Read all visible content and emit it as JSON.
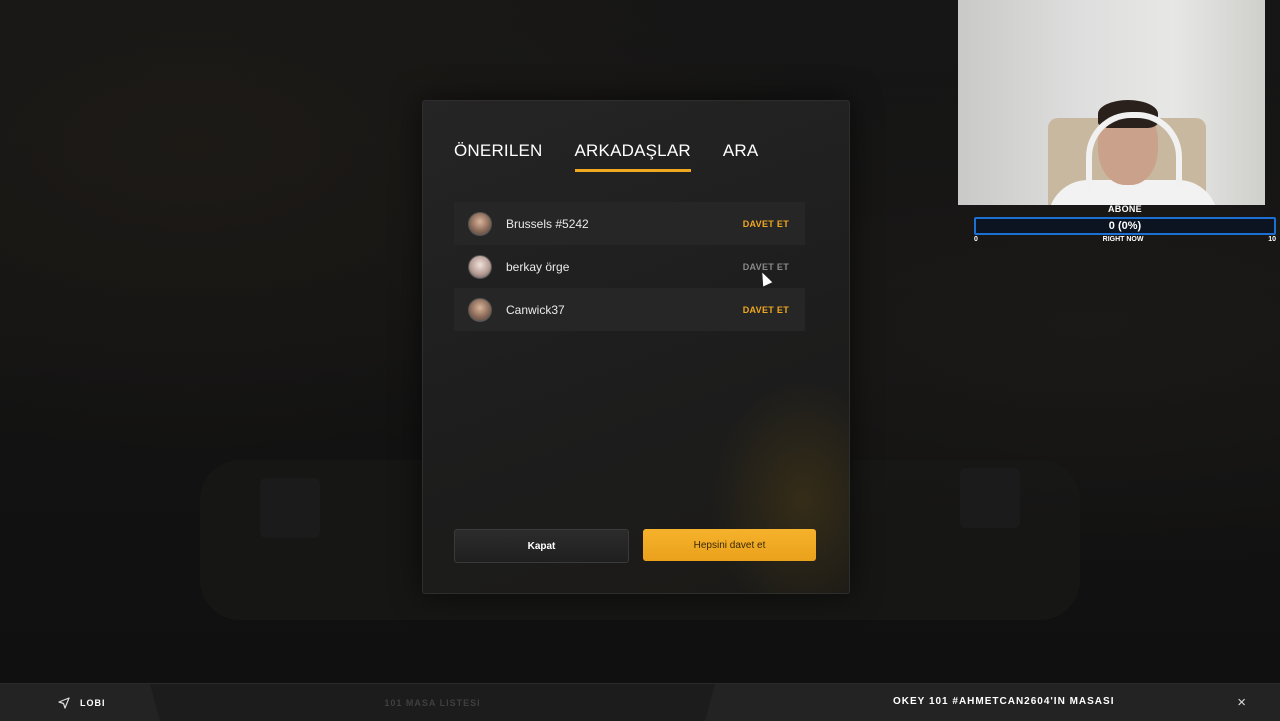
{
  "modal": {
    "tabs": [
      {
        "label": "ÖNERILEN",
        "active": false
      },
      {
        "label": "ARKADAŞLAR",
        "active": true
      },
      {
        "label": "ARA",
        "active": false
      }
    ],
    "friends": [
      {
        "name": "Brussels #5242",
        "action": "DAVET ET"
      },
      {
        "name": "berkay örge",
        "action": "DAVET ET"
      },
      {
        "name": "Canwick37",
        "action": "DAVET ET"
      }
    ],
    "close_label": "Kapat",
    "invite_all_label": "Hepsini davet et",
    "accent_color": "#f0a820"
  },
  "webcam_overlay": {
    "title": "ABONE",
    "progress_text": "0 (0%)",
    "progress_value": 0,
    "scale_min": "0",
    "scale_label": "RIGHT NOW",
    "scale_max": "10"
  },
  "bottom_bar": {
    "lobby_label": "LOBI",
    "list_label": "101 MASA LISTESI",
    "table_label": "OKEY 101 #AHMETCAN2604'IN MASASI",
    "close_symbol": "×"
  }
}
